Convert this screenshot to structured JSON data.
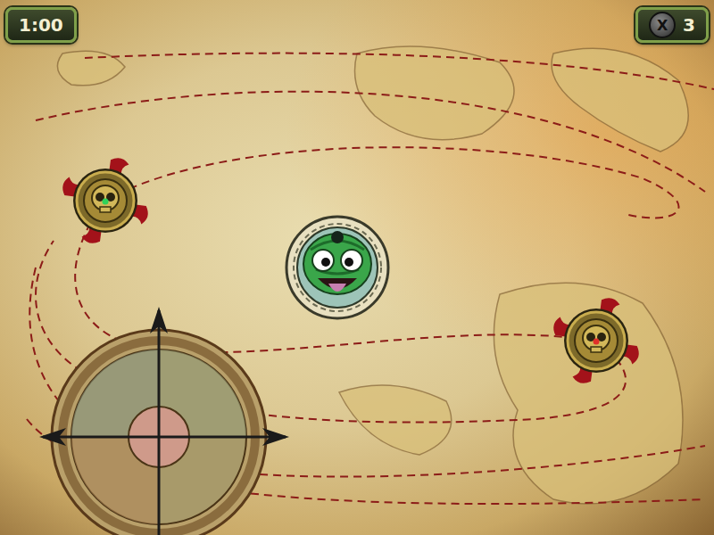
{
  "hud": {
    "timer": "1:00",
    "lives": {
      "icon": "X",
      "count": "3"
    }
  },
  "holes": [
    {
      "name": "left-skull",
      "color": "#2fd25a"
    },
    {
      "name": "right-skull",
      "color": "#e0302a"
    }
  ]
}
